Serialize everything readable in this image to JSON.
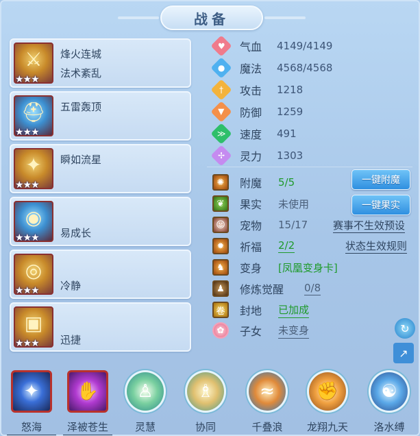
{
  "title": "战备",
  "cards": [
    {
      "line1": "烽火连城",
      "line2": "法术紊乱",
      "stars": "★★★",
      "icon": "sword-fire-icon",
      "color": "#c88a2a"
    },
    {
      "line1": "五雷轰顶",
      "line2": "",
      "stars": "★★★",
      "icon": "thunder-helmet-icon",
      "color": "#3c8fd0"
    },
    {
      "line1": "瞬如流星",
      "line2": "",
      "stars": "★★★",
      "icon": "gold-armor-icon",
      "color": "#c88a2a"
    },
    {
      "line1": "",
      "line2": "易成长",
      "stars": "★★★",
      "icon": "blue-ring-icon",
      "color": "#3c8fd0"
    },
    {
      "line1": "",
      "line2": "冷静",
      "stars": "★★★",
      "icon": "gold-ring-icon",
      "color": "#c88a2a"
    },
    {
      "line1": "",
      "line2": "迅捷",
      "stars": "★★★",
      "icon": "gold-bracer-icon",
      "color": "#c88a2a"
    }
  ],
  "stats": [
    {
      "label": "气血",
      "value": "4149/4149",
      "icon": "heart-icon",
      "color": "#f07b8c"
    },
    {
      "label": "魔法",
      "value": "4568/4568",
      "icon": "mana-icon",
      "color": "#4fb1f0"
    },
    {
      "label": "攻击",
      "value": "1218",
      "icon": "sword-icon",
      "color": "#f3b33c"
    },
    {
      "label": "防御",
      "value": "1259",
      "icon": "shield-icon",
      "color": "#f4904a"
    },
    {
      "label": "速度",
      "value": "491",
      "icon": "speed-icon",
      "color": "#2ebf6a"
    },
    {
      "label": "灵力",
      "value": "1303",
      "icon": "spirit-icon",
      "color": "#c58bf0"
    }
  ],
  "extras": {
    "enchant": {
      "label": "附魔",
      "value": "5/5"
    },
    "fruit": {
      "label": "果实",
      "value": "未使用"
    },
    "pet": {
      "label": "宠物",
      "value": "15/17"
    },
    "blessing": {
      "label": "祈福",
      "value": "2/2"
    },
    "transform": {
      "label": "变身",
      "value": "[凤凰变身卡]"
    },
    "cultivation": {
      "label": "修炼觉醒",
      "value": "0/8"
    },
    "fief": {
      "label": "封地",
      "value": "已加成"
    },
    "child": {
      "label": "子女",
      "value": "未变身"
    }
  },
  "buttons": {
    "enchant": "一键附魔",
    "fruit": "一键果实"
  },
  "links": {
    "event_preview": "赛事不生效预设",
    "status_rules": "状态生效规则"
  },
  "bottom_skills": [
    {
      "label": "怒海",
      "icon": "sea-orb-icon",
      "color": "#3a6fd8"
    },
    {
      "label": "泽被苍生",
      "icon": "purple-hand-icon",
      "color": "#b03ad0"
    },
    {
      "label": "灵慧",
      "icon": "wisdom-figure-icon",
      "color": "#7ad0a0"
    },
    {
      "label": "协同",
      "icon": "twin-figure-icon",
      "color": "#e0c070"
    },
    {
      "label": "千叠浪",
      "icon": "wave-icon",
      "color": "#e08a3a"
    },
    {
      "label": "龙翔九天",
      "icon": "dragon-fist-icon",
      "color": "#f0a040"
    },
    {
      "label": "洛水缚",
      "icon": "water-dragon-icon",
      "color": "#5aa8e8"
    }
  ]
}
